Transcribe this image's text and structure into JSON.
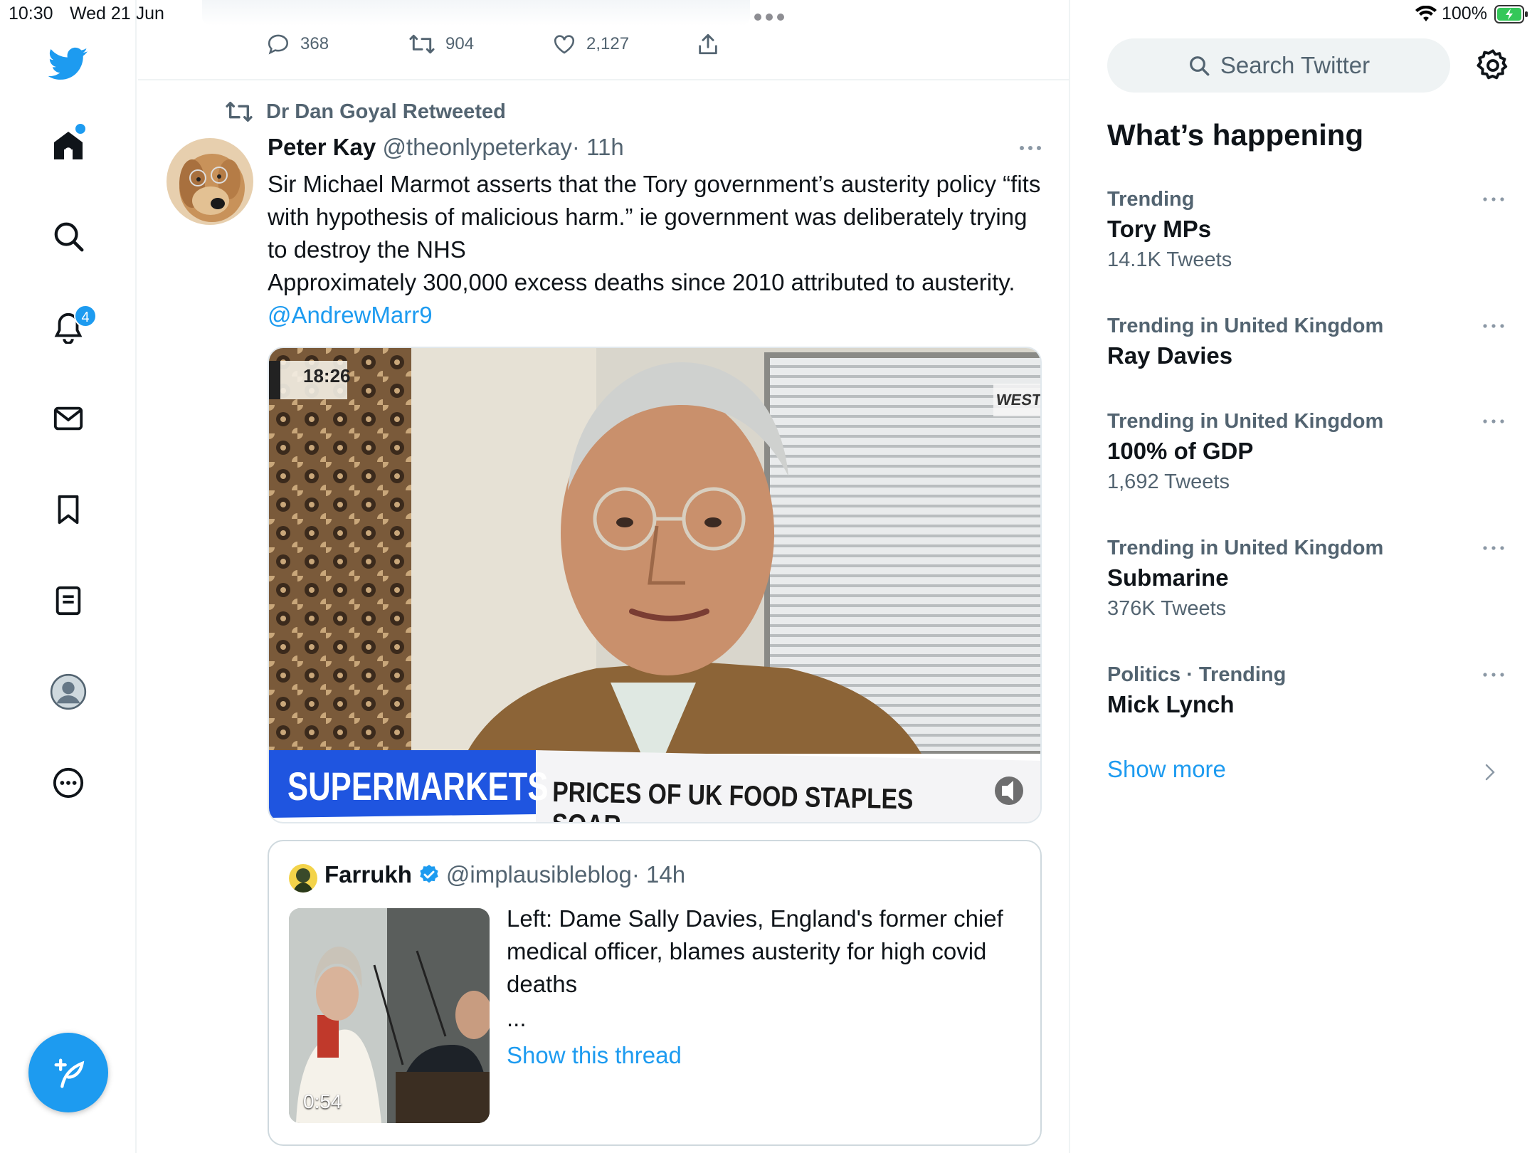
{
  "status_bar": {
    "time": "10:30",
    "date": "Wed 21 Jun",
    "battery": "100%"
  },
  "nav": {
    "items": [
      "home-icon",
      "explore-icon",
      "notifications-icon",
      "messages-icon",
      "bookmarks-icon",
      "lists-icon",
      "profile-icon",
      "more-icon"
    ],
    "notification_count": "4",
    "compose_icon": "compose-icon"
  },
  "prev_tweet_actions": {
    "replies": "368",
    "retweets": "904",
    "likes": "2,127"
  },
  "tweet": {
    "retweeted_by": "Dr Dan Goyal Retweeted",
    "author_name": "Peter Kay",
    "author_handle": "@theonlypeterkay",
    "time": "· 11h",
    "text": "Sir Michael Marmot asserts that the Tory government’s austerity policy “fits with hypothesis of malicious harm.” ie government was deliberately trying to destroy the NHS\nApproximately 300,000 excess deaths since 2010 attributed to austerity. ",
    "mention": "@AndrewMarr9",
    "video": {
      "timestamp": "18:26",
      "channel_tag": "WESTM",
      "ticker_left": "SUPERMARKETS",
      "ticker_right": "PRICES OF UK FOOD STAPLES SOAR"
    }
  },
  "quote": {
    "author_name": "Farrukh",
    "author_handle": "@implausibleblog",
    "time": "· 14h",
    "text": "Left: Dame Sally Davies, England's former chief medical officer, blames austerity for high covid deaths",
    "ellipsis": "...",
    "show_thread": "Show this thread",
    "duration": "0:54"
  },
  "right": {
    "search_placeholder": "Search Twitter",
    "heading": "What’s happening",
    "trends": [
      {
        "context": "Trending",
        "name": "Tory MPs",
        "count": "14.1K Tweets"
      },
      {
        "context": "Trending in United Kingdom",
        "name": "Ray Davies",
        "count": ""
      },
      {
        "context": "Trending in United Kingdom",
        "name": "100% of GDP",
        "count": "1,692 Tweets"
      },
      {
        "context": "Trending in United Kingdom",
        "name": "Submarine",
        "count": "376K Tweets"
      },
      {
        "context": "Politics · Trending",
        "name": "Mick Lynch",
        "count": ""
      }
    ],
    "show_more": "Show more"
  },
  "colors": {
    "accent": "#1d9bf0",
    "text": "#0f1419",
    "secondary": "#536471",
    "border": "#eff3f4"
  }
}
